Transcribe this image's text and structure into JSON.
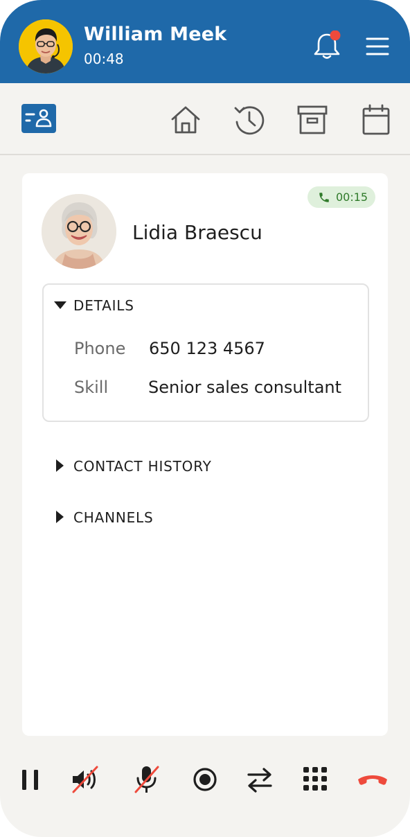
{
  "agent": {
    "name": "William Meek",
    "timer": "00:48"
  },
  "notifications": {
    "has_unread": true
  },
  "toolbar": {
    "items": [
      {
        "icon": "contact-card-icon",
        "active": true
      },
      {
        "icon": "home-icon"
      },
      {
        "icon": "history-icon"
      },
      {
        "icon": "archive-icon"
      },
      {
        "icon": "calendar-icon"
      }
    ]
  },
  "contact": {
    "name": "Lidia Braescu",
    "call_timer": "00:15"
  },
  "details": {
    "heading": "DETAILS",
    "fields": [
      {
        "label": "Phone",
        "value": "650 123 4567"
      },
      {
        "label": "Skill",
        "value": "Senior sales consultant"
      }
    ]
  },
  "sections": {
    "contact_history": "CONTACT HISTORY",
    "channels": "CHANNELS"
  },
  "call_controls": [
    "hold-icon",
    "speaker-muted-icon",
    "mic-muted-icon",
    "record-icon",
    "transfer-icon",
    "dialpad-icon",
    "hang-up-icon"
  ],
  "colors": {
    "header": "#1f69a9",
    "accent": "#1f69a9",
    "notification_dot": "#ee4a3c",
    "call_badge_bg": "#dff0dc",
    "call_badge_text": "#2f7a2a",
    "hang_up": "#ee4a3c"
  }
}
